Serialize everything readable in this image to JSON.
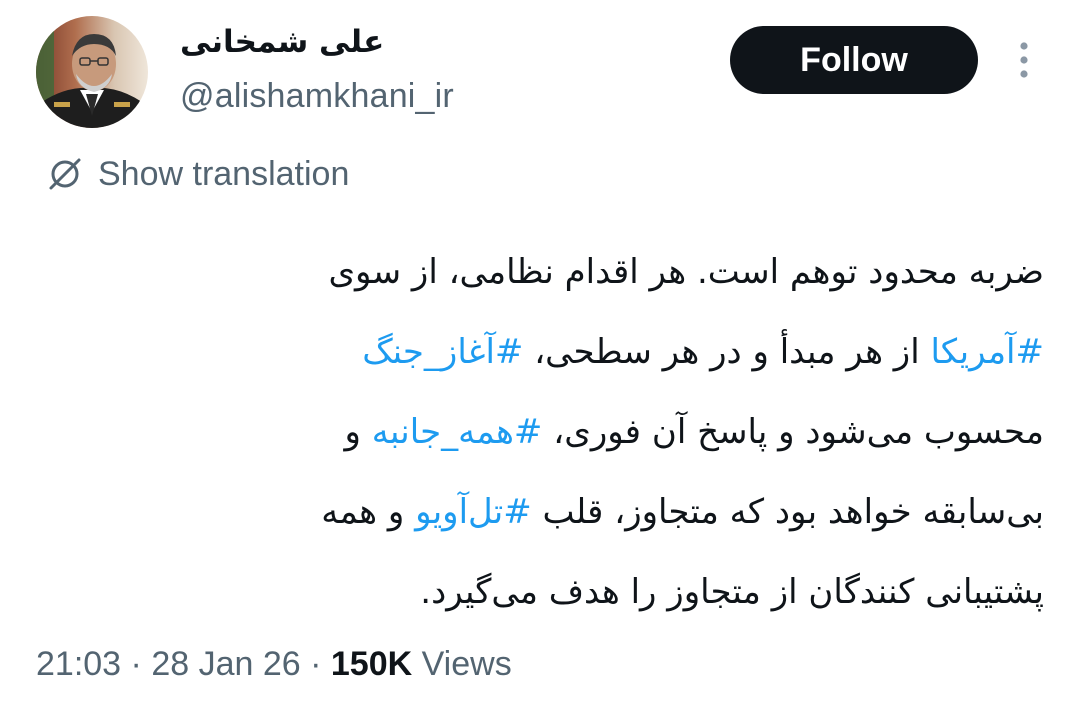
{
  "author": {
    "display_name": "علی شمخانی",
    "handle": "@alishamkhani_ir",
    "avatar_icon": "profile-photo"
  },
  "actions": {
    "follow_label": "Follow",
    "more_icon": "more-vertical-icon"
  },
  "translation": {
    "label": "Show translation",
    "icon": "translate-icon"
  },
  "tweet": {
    "line1": {
      "t1": "ضربه محدود توهم است. هر اقدام نظامی، از سوی"
    },
    "line2": {
      "h1": "#آمریکا",
      "t1": " از هر مبدأ و در هر سطحی، ",
      "h2": "#آغاز_جنگ"
    },
    "line3": {
      "t1": "محسوب می‌شود و پاسخ آن فوری، ",
      "h1": "#همه_جانبه",
      "t2": " و"
    },
    "line4": {
      "t1": "بی‌سابقه خواهد بود که متجاوز، قلب ",
      "h1": "#تل‌آویو",
      "t2": " و همه"
    },
    "line5": {
      "t1": "پشتیبانی کنندگان از متجاوز را هدف می‌گیرد."
    }
  },
  "meta": {
    "time": "21:03",
    "sep1": " · ",
    "date": "28 Jan 26",
    "sep2": " · ",
    "views_count": "150K",
    "views_label": " Views"
  },
  "colors": {
    "link": "#1d9bf0",
    "secondary_text": "#536471",
    "primary_text": "#0f1419",
    "follow_bg": "#0f1419"
  }
}
